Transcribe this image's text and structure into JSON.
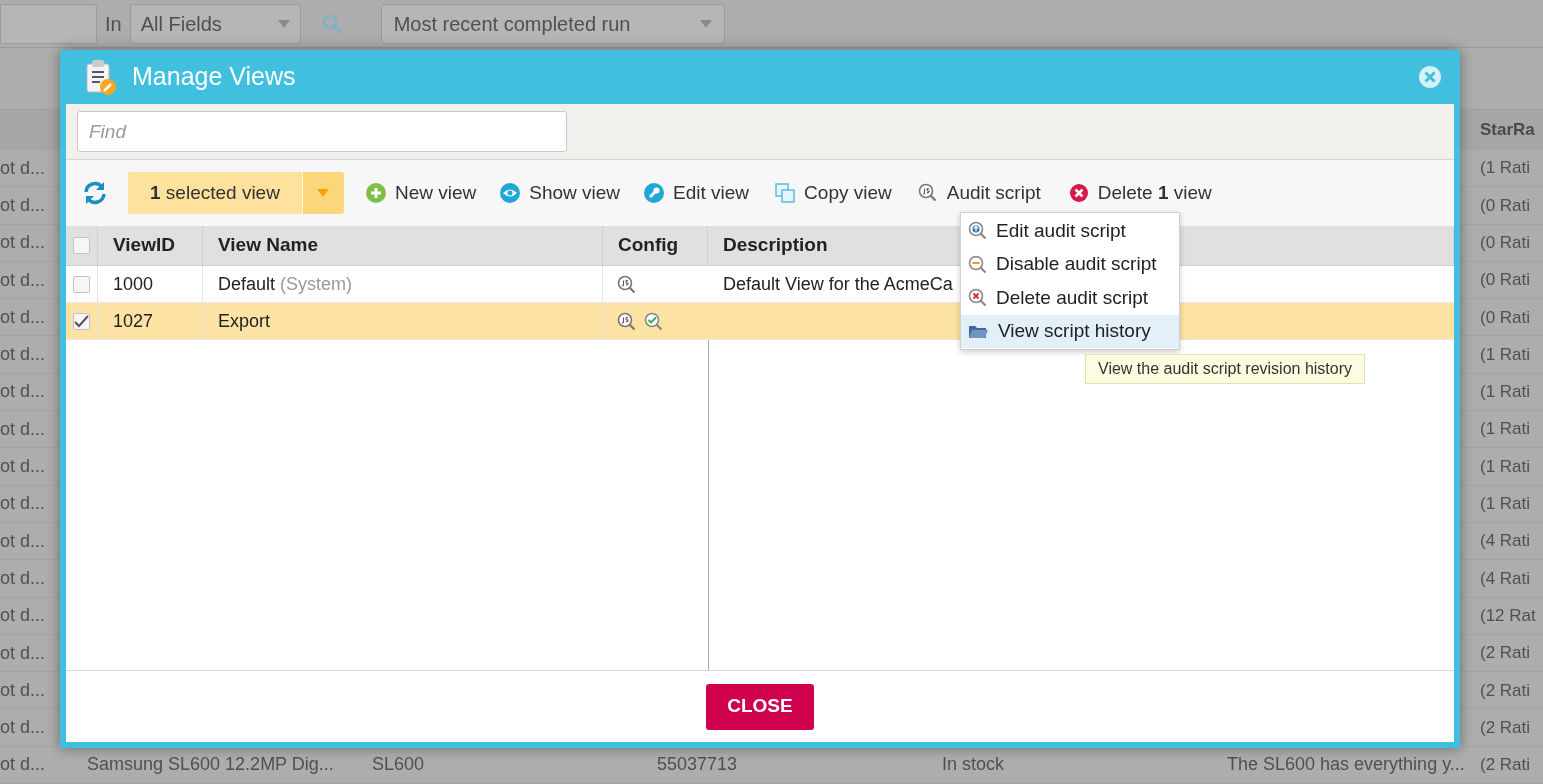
{
  "background": {
    "scope_label": "In",
    "field_select": "All Fields",
    "run_select": "Most recent completed run",
    "last_header": "StarRa",
    "rows": [
      {
        "first": "ot d...",
        "last": "(1 Rati"
      },
      {
        "first": "ot d...",
        "last": "(0 Rati"
      },
      {
        "first": "ot d...",
        "last": "(0 Rati"
      },
      {
        "first": "ot d...",
        "last": "(0 Rati"
      },
      {
        "first": "ot d...",
        "last": "(0 Rati"
      },
      {
        "first": "ot d...",
        "last": "(1 Rati"
      },
      {
        "first": "ot d...",
        "last": "(1 Rati"
      },
      {
        "first": "ot d...",
        "last": "(1 Rati"
      },
      {
        "first": "ot d...",
        "last": "(1 Rati"
      },
      {
        "first": "ot d...",
        "last": "(1 Rati"
      },
      {
        "first": "ot d...",
        "last": "(4 Rati"
      },
      {
        "first": "ot d...",
        "last": "(4 Rati"
      },
      {
        "first": "ot d...",
        "last": "(12 Rat"
      },
      {
        "first": "ot d...",
        "last": "(2 Rati"
      },
      {
        "first": "ot d...",
        "last": "(2 Rati"
      },
      {
        "first": "ot d...",
        "last": "(2 Rati"
      },
      {
        "first": "ot d...",
        "middle": [
          "Samsung SL600 12.2MP Dig...",
          "SL600",
          "55037713",
          "In stock",
          "The SL600 has everything y..."
        ],
        "last": "(2 Rati"
      }
    ]
  },
  "dialog": {
    "title": "Manage Views",
    "find_placeholder": "Find",
    "selection_button": "**1** selected view",
    "toolbar": [
      {
        "kind": "new",
        "label": "New view"
      },
      {
        "kind": "show",
        "label": "Show view"
      },
      {
        "kind": "edit",
        "label": "Edit view"
      },
      {
        "kind": "copy",
        "label": "Copy view"
      },
      {
        "kind": "audit",
        "label": "Audit script"
      },
      {
        "kind": "delete",
        "label": "Delete **1** view"
      }
    ],
    "all_checked": false,
    "columns": [
      "ViewID",
      "View Name",
      "Config",
      "Description"
    ],
    "rows": [
      {
        "checked": false,
        "selected": false,
        "id": "1000",
        "name": "Default",
        "name_note": "(System)",
        "config": [
          {
            "kind": "script"
          }
        ],
        "description": "Default View for the AcmeCa"
      },
      {
        "checked": true,
        "selected": true,
        "id": "1027",
        "name": "Export",
        "config": [
          {
            "kind": "script"
          },
          {
            "kind": "validated"
          }
        ]
      }
    ],
    "audit_menu": [
      {
        "kind": "edit",
        "label": "Edit audit script",
        "selected": false
      },
      {
        "kind": "disable",
        "label": "Disable audit script",
        "selected": false
      },
      {
        "kind": "delete",
        "label": "Delete audit script",
        "selected": false
      },
      {
        "kind": "history",
        "label": "View script history",
        "selected": true
      }
    ],
    "tooltip": "View the audit script revision history",
    "close_button": "CLOSE"
  }
}
